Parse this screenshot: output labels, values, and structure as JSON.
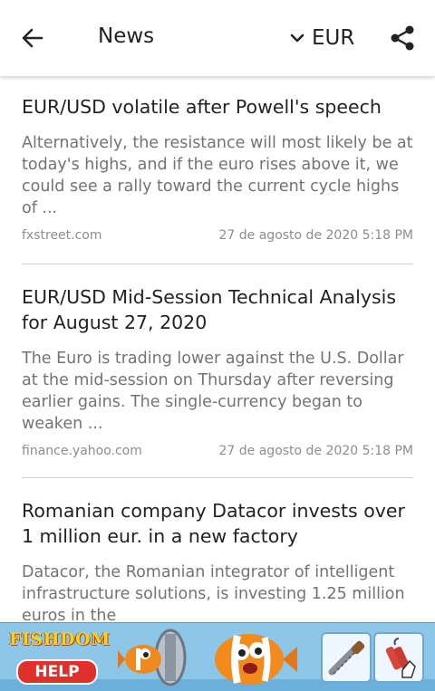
{
  "header": {
    "title": "News",
    "currency": "EUR",
    "icons": {
      "back": "arrow-left-icon",
      "dropdown": "chevron-down-icon",
      "share": "share-icon"
    }
  },
  "articles": [
    {
      "title": "EUR/USD volatile after Powell's speech",
      "snippet": "Alternatively, the resistance will most likely be at today's highs, and if the euro rises above it, we could see a rally toward the current cycle highs of ...",
      "source": "fxstreet.com",
      "date": "27 de agosto de 2020 5:18 PM"
    },
    {
      "title": "EUR/USD Mid-Session Technical Analysis for August 27, 2020",
      "snippet": "The Euro is trading lower against the U.S. Dollar at the mid-session on Thursday after reversing earlier gains. The single-currency began to weaken ...",
      "source": "finance.yahoo.com",
      "date": "27 de agosto de 2020 5:18 PM"
    },
    {
      "title": "Romanian company Datacor invests over 1 million eur. in a new factory",
      "snippet": "Datacor, the Romanian integrator of intelligent infrastructure solutions, is investing 1.25 million euros in the"
    }
  ],
  "ad": {
    "brand": "FISHDOM",
    "button": "HELP",
    "colors": {
      "background": "#8cc7ea",
      "brand": "#ffcf26",
      "button": "#e0302c"
    }
  }
}
